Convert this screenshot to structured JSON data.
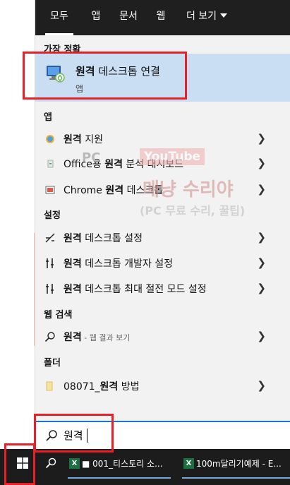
{
  "tabs": [
    {
      "label": "모두",
      "active": true
    },
    {
      "label": "앱"
    },
    {
      "label": "문서"
    },
    {
      "label": "웹"
    },
    {
      "label": "더 보기"
    }
  ],
  "sections": {
    "best": "가장 정확",
    "apps": "앱",
    "settings": "설정",
    "web": "웹 검색",
    "folders": "폴더"
  },
  "best_match": {
    "bold": "원격",
    "rest": " 데스크톱 연결",
    "type": "앱"
  },
  "apps": [
    {
      "bold": "원격",
      "pre": "",
      "rest": " 지원",
      "icon": "remote-assistance-icon"
    },
    {
      "bold": "원격",
      "pre": "Office용 ",
      "rest": " 분석 대시보드",
      "icon": "office-icon"
    },
    {
      "bold": "원격",
      "pre": "Chrome ",
      "rest": " 데스크톱",
      "icon": "chrome-remote-icon"
    }
  ],
  "settings": [
    {
      "bold": "원격",
      "rest": " 데스크톱 설정",
      "icon": "remote-desktop-settings-icon"
    },
    {
      "bold": "원격",
      "rest": " 데스크톱 개발자 설정",
      "icon": "developer-settings-icon"
    },
    {
      "bold": "원격",
      "rest": " 데스크톱 최대 절전 모드 설정",
      "icon": "sleep-settings-icon"
    }
  ],
  "web_search": {
    "query": "원격",
    "suffix": " - 웹 결과 보기"
  },
  "folder": {
    "pre": "08071_",
    "bold": "원격",
    "rest": " 방법"
  },
  "search": {
    "value": "원격"
  },
  "watermark": {
    "line1": "PC",
    "line2": "YouTube",
    "line3": "매냥 수리야",
    "line4": "(PC 무료 수리, 꿀팁)"
  },
  "taskbar": {
    "items": [
      {
        "label": "■ 001_티스토리 소..."
      },
      {
        "label": "100m달리기예제 - E..."
      }
    ]
  },
  "colors": {
    "accent": "#1976d2",
    "highlight": "#c9def3",
    "topbar": "#1f1f1f",
    "taskbar": "#1c1c1c",
    "redbox": "#e8202a"
  }
}
